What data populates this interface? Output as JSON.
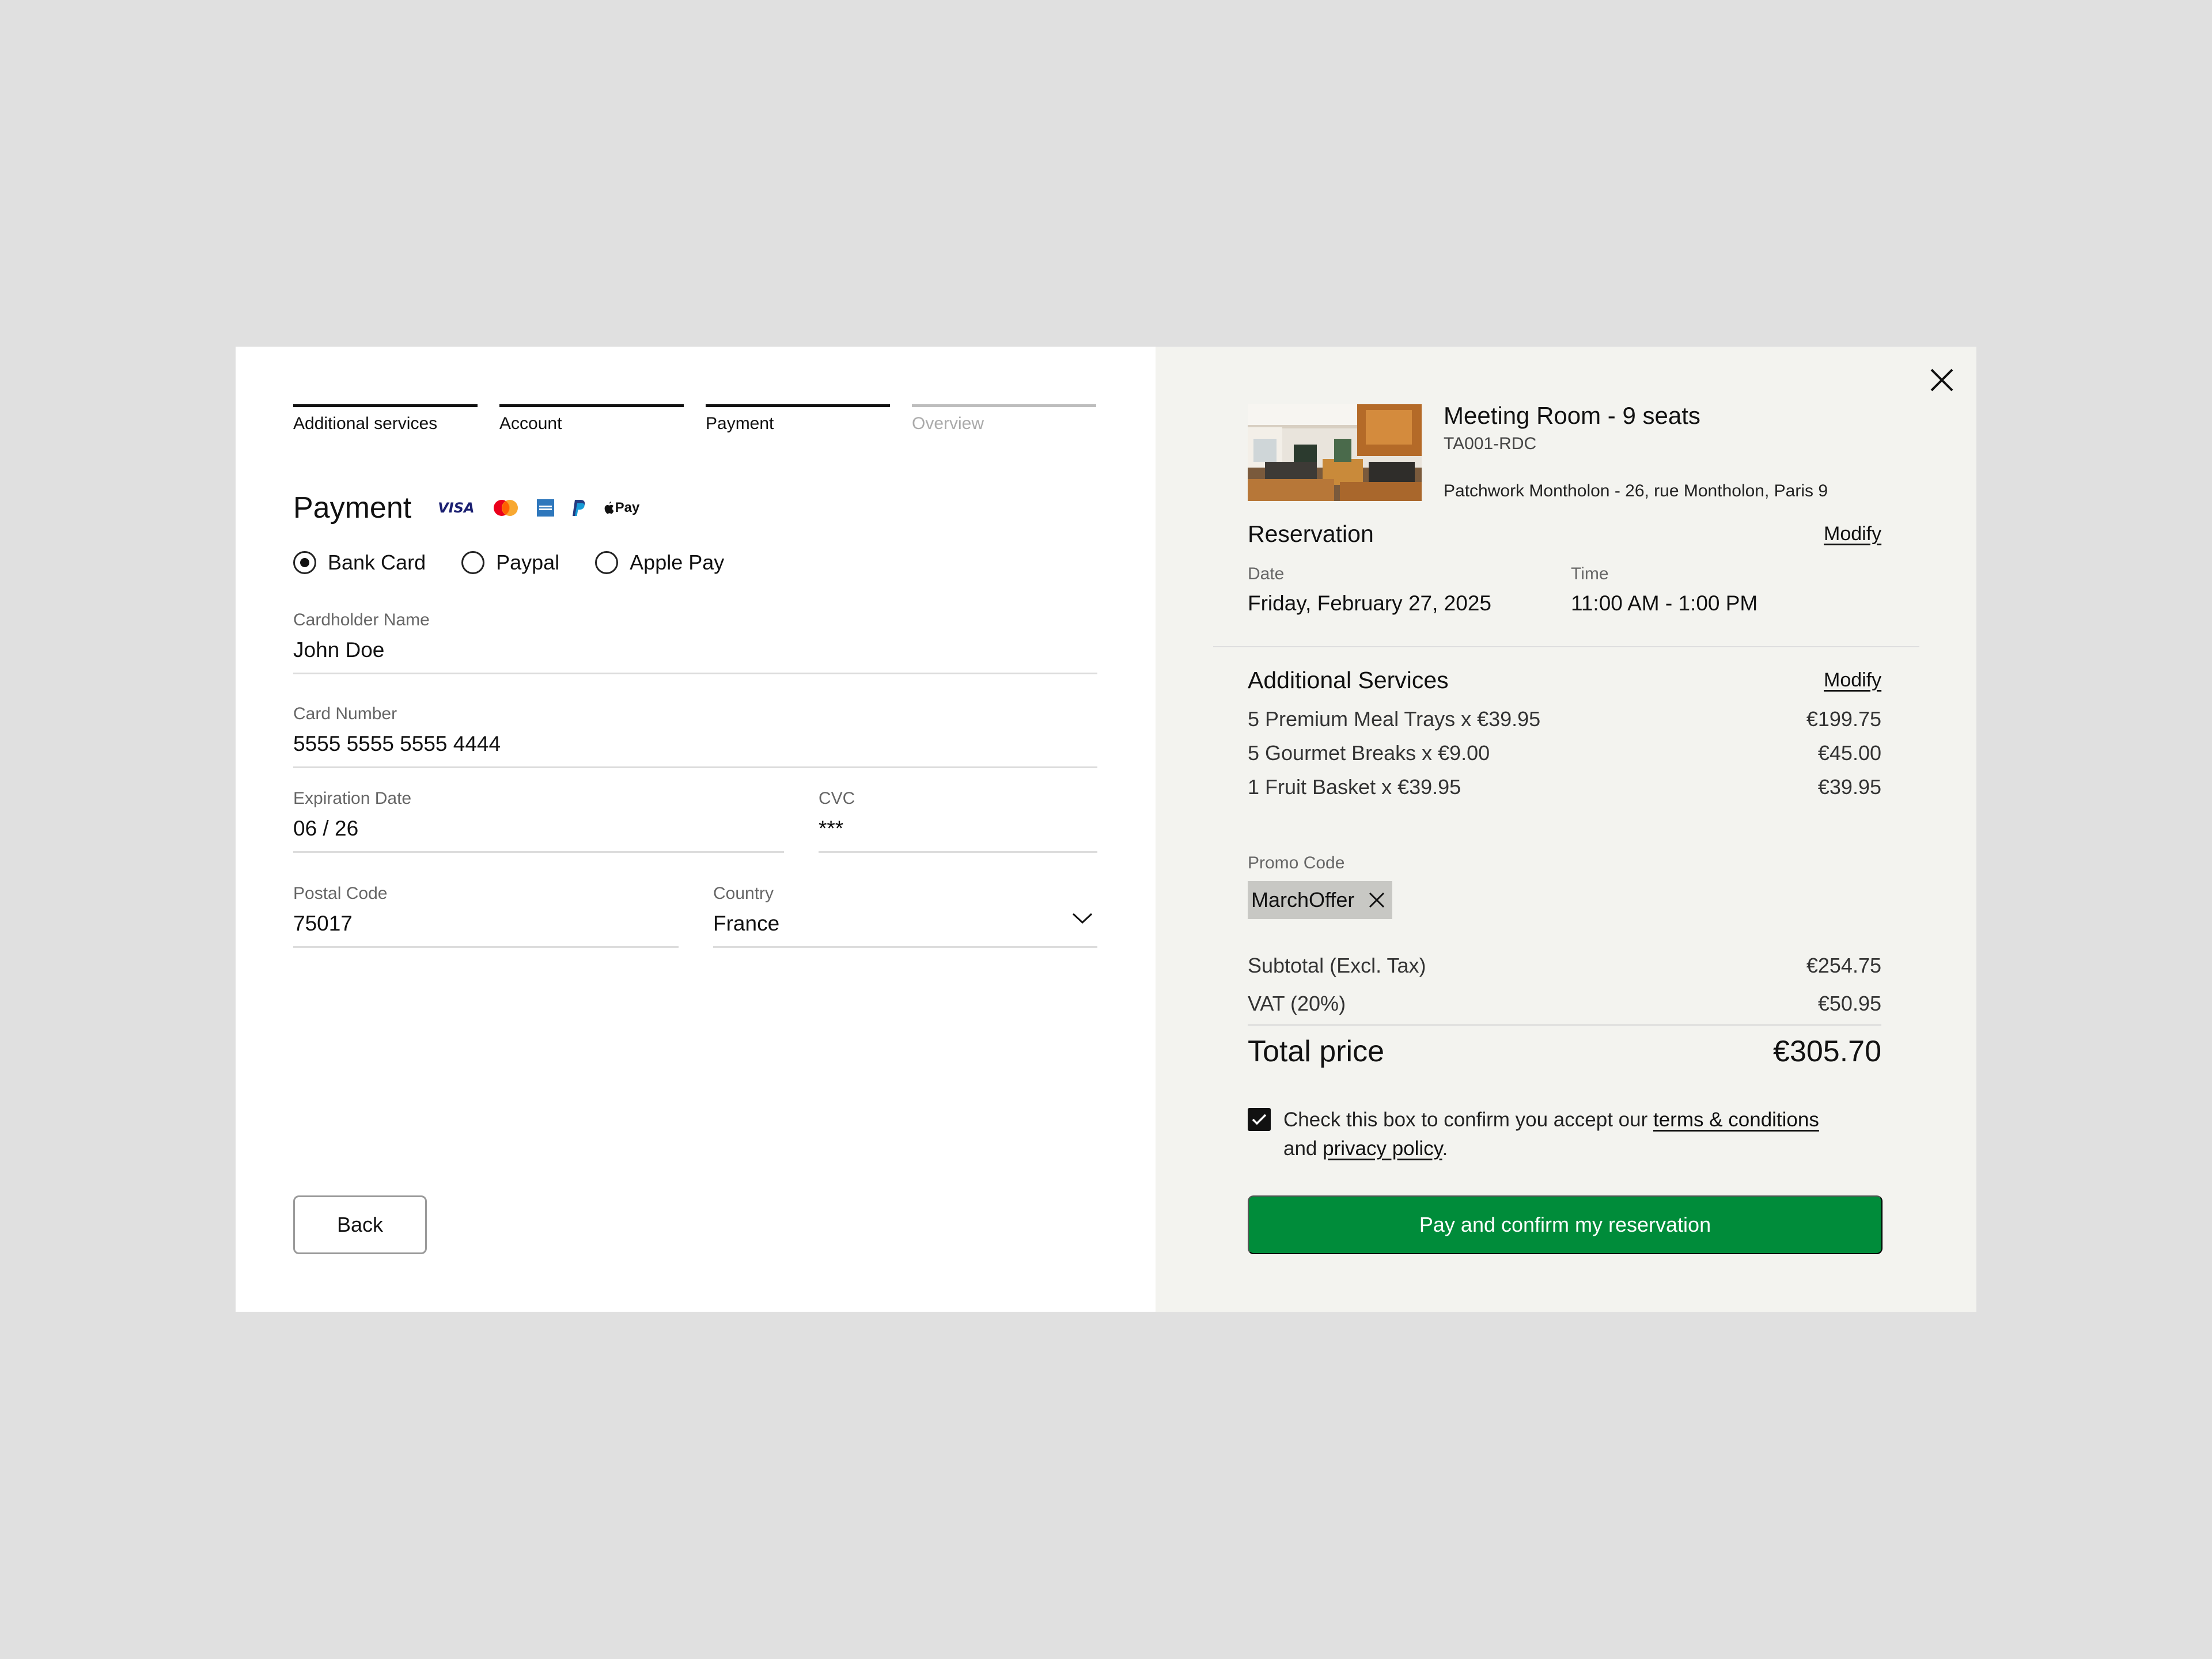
{
  "stepper": {
    "steps": [
      {
        "label": "Additional services",
        "state": "done"
      },
      {
        "label": "Account",
        "state": "done"
      },
      {
        "label": "Payment",
        "state": "current"
      },
      {
        "label": "Overview",
        "state": "upcoming"
      }
    ]
  },
  "payment": {
    "title": "Payment",
    "logos": [
      "VISA",
      "mastercard-icon",
      "amex-icon",
      "paypal-icon",
      "Pay"
    ],
    "methods": [
      {
        "label": "Bank Card",
        "selected": true
      },
      {
        "label": "Paypal",
        "selected": false
      },
      {
        "label": "Apple Pay",
        "selected": false
      }
    ],
    "fields": {
      "cardholder": {
        "label": "Cardholder Name",
        "value": "John Doe"
      },
      "card_number": {
        "label": "Card Number",
        "value": "5555 5555 5555 4444"
      },
      "expiration": {
        "label": "Expiration Date",
        "value": "06 / 26"
      },
      "cvc": {
        "label": "CVC",
        "value": "***"
      },
      "postal": {
        "label": "Postal Code",
        "value": "75017"
      },
      "country": {
        "label": "Country",
        "value": "France"
      }
    },
    "back_label": "Back"
  },
  "summary": {
    "room": {
      "title": "Meeting Room - 9 seats",
      "code": "TA001-RDC",
      "address": "Patchwork Montholon - 26, rue Montholon, Paris 9"
    },
    "reservation": {
      "title": "Reservation",
      "modify": "Modify",
      "date_label": "Date",
      "date_value": "Friday, February 27, 2025",
      "time_label": "Time",
      "time_value": "11:00 AM - 1:00 PM"
    },
    "services": {
      "title": "Additional Services",
      "modify": "Modify",
      "items": [
        {
          "name": "5 Premium Meal Trays x €39.95",
          "price": "€199.75"
        },
        {
          "name": "5 Gourmet Breaks x €9.00",
          "price": "€45.00"
        },
        {
          "name": "1 Fruit Basket x €39.95",
          "price": "€39.95"
        }
      ]
    },
    "promo": {
      "label": "Promo Code",
      "code": "MarchOffer"
    },
    "totals": {
      "subtotal_label": "Subtotal (Excl. Tax)",
      "subtotal_value": "€254.75",
      "vat_label": "VAT (20%)",
      "vat_value": "€50.95",
      "total_label": "Total price",
      "total_value": "€305.70"
    },
    "terms": {
      "checked": true,
      "prefix": "Check this box to confirm you accept our ",
      "terms_link": "terms & conditions",
      "middle": " and ",
      "privacy_link": "privacy policy",
      "suffix": "."
    },
    "pay_label": "Pay and confirm my reservation"
  },
  "colors": {
    "background": "#e0e0e0",
    "summary_bg": "#f3f3ef",
    "primary_green": "#008c3a"
  }
}
